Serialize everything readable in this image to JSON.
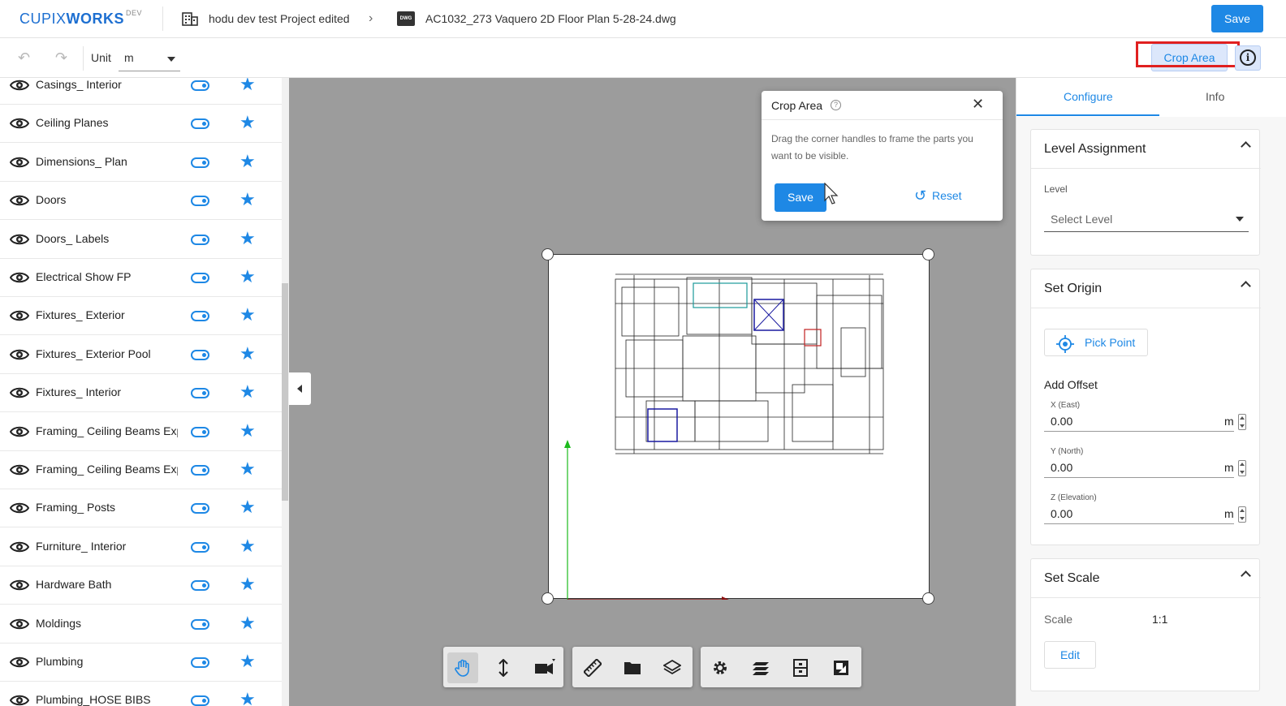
{
  "header": {
    "logo_main": "CUPIX",
    "logo_bold": "WORKS",
    "logo_env": "DEV",
    "project_name": "hodu dev test Project edited",
    "file_badge": "DWG",
    "file_name": "AC1032_273 Vaquero 2D Floor Plan 5-28-24.dwg",
    "save_label": "Save"
  },
  "toolbar": {
    "unit_label": "Unit",
    "unit_value": "m",
    "crop_area_label": "Crop Area",
    "info_glyph": "i"
  },
  "layers": [
    {
      "name": "Casings_ Interior"
    },
    {
      "name": "Ceiling Planes"
    },
    {
      "name": "Dimensions_ Plan"
    },
    {
      "name": "Doors"
    },
    {
      "name": "Doors_ Labels"
    },
    {
      "name": "Electrical Show FP"
    },
    {
      "name": "Fixtures_ Exterior"
    },
    {
      "name": "Fixtures_ Exterior Pool"
    },
    {
      "name": "Fixtures_ Interior"
    },
    {
      "name": "Framing_ Ceiling Beams Exp"
    },
    {
      "name": "Framing_ Ceiling Beams Exp"
    },
    {
      "name": "Framing_ Posts"
    },
    {
      "name": "Furniture_ Interior"
    },
    {
      "name": "Hardware Bath"
    },
    {
      "name": "Moldings"
    },
    {
      "name": "Plumbing"
    },
    {
      "name": "Plumbing_HOSE BIBS"
    }
  ],
  "crop_popup": {
    "title": "Crop Area",
    "help_glyph": "?",
    "close_glyph": "✕",
    "description": "Drag the corner handles to frame the parts you want to be visible.",
    "save_label": "Save",
    "reset_label": "Reset",
    "reset_glyph": "↺"
  },
  "right_panel": {
    "tabs": [
      {
        "label": "Configure",
        "active": true
      },
      {
        "label": "Info",
        "active": false
      }
    ],
    "level_assignment": {
      "title": "Level Assignment",
      "level_label": "Level",
      "level_placeholder": "Select Level"
    },
    "set_origin": {
      "title": "Set Origin",
      "pick_point_label": "Pick Point",
      "add_offset_label": "Add Offset",
      "fields": [
        {
          "label": "X (East)",
          "value": "0.00",
          "unit": "m"
        },
        {
          "label": "Y (North)",
          "value": "0.00",
          "unit": "m"
        },
        {
          "label": "Z (Elevation)",
          "value": "0.00",
          "unit": "m"
        }
      ]
    },
    "set_scale": {
      "title": "Set Scale",
      "scale_label": "Scale",
      "scale_value": "1:1",
      "edit_label": "Edit"
    }
  },
  "bottom_tools": {
    "group1": [
      "pan-hand-icon",
      "vertical-move-icon",
      "camera-icon"
    ],
    "group2": [
      "ruler-icon",
      "folder-icon",
      "layers-stack-icon"
    ],
    "group3": [
      "settings-gear-icon",
      "layers-icon",
      "level-icon",
      "crop-image-icon"
    ]
  },
  "colors": {
    "accent": "#1e88e5",
    "canvas_bg": "#9c9c9c",
    "highlight_red": "#e02020"
  }
}
